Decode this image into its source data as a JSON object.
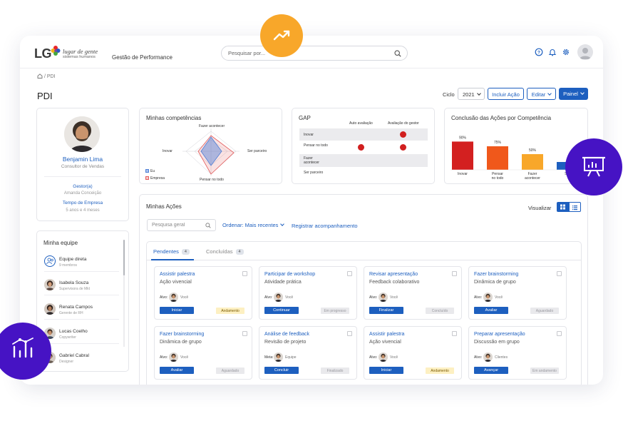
{
  "header": {
    "logo_letters": "LG",
    "logo_tagline": "lugar de gente",
    "logo_subline": "sistemas humanos",
    "app_title": "Gestão de Performance",
    "search_placeholder": "Pesquisar por..."
  },
  "breadcrumb": "/ PDI",
  "page": {
    "title": "PDI",
    "cycle_label": "Ciclo",
    "cycle_value": "2021",
    "btn_incluir": "Incluir Ação",
    "btn_editar": "Editar",
    "btn_painel": "Painel"
  },
  "profile": {
    "name": "Benjamin Lima",
    "role": "Consultor de Vendas",
    "manager_label": "Gestor(a)",
    "manager_value": "Amanda Conceição",
    "tenure_label": "Tempo de Empresa",
    "tenure_value": "5 anos e 4 meses"
  },
  "team": {
    "title": "Minha equipe",
    "members": [
      {
        "name": "Equipe direta",
        "sub": "9 membros"
      },
      {
        "name": "Isabela Souza",
        "sub": "Supervisora de Mkt"
      },
      {
        "name": "Renata Campos",
        "sub": "Gerente de RH"
      },
      {
        "name": "Lucas Coelho",
        "sub": "Copywriter"
      },
      {
        "name": "Gabriel Cabral",
        "sub": "Designer"
      }
    ]
  },
  "competencias": {
    "title": "Minhas competências",
    "axes": [
      "Fazer acontecer",
      "Ser parceiro",
      "Pensar no todo",
      "Inovar"
    ],
    "legend_eu": "Eu",
    "legend_empresa": "Empresa",
    "colors": {
      "eu": "#4f7fd6",
      "empresa": "#e35c5c"
    }
  },
  "gap": {
    "title": "GAP",
    "col_auto": "Auto avaliação",
    "col_gestor": "Avaliação do gestor",
    "rows": [
      "Inovar",
      "Pensar no todo",
      "Fazer acontecer",
      "Ser parceiro"
    ],
    "dot_color": "#d11f1f"
  },
  "chart_data": {
    "type": "bar",
    "title": "Conclusão das Ações por Competência",
    "categories": [
      "Inovar",
      "Pensar no todo",
      "Fazer acontecer",
      "Ser parceiro"
    ],
    "values": [
      90,
      75,
      50,
      25
    ],
    "value_labels": [
      "90%",
      "75%",
      "50%",
      ""
    ],
    "category_labels": [
      "Inovar",
      "Pensar no todo",
      "Fazer acontecer",
      "Ser"
    ],
    "colors": [
      "#d32020",
      "#f0581b",
      "#f8a72a",
      "#1d5fbf"
    ],
    "ylim": [
      0,
      100
    ]
  },
  "acoes": {
    "title": "Minhas Ações",
    "visualizar": "Visualizar",
    "search_placeholder": "Pesquisa geral",
    "ordenar": "Ordenar: Mais recentes",
    "registrar": "Registrar acompanhamento",
    "tabs": [
      {
        "label": "Pendentes",
        "count": "4"
      },
      {
        "label": "Concluídas",
        "count": "4"
      }
    ],
    "cards": [
      {
        "title": "Assistir palestra",
        "sub": "Ação vivencial",
        "meta_lbl": "Alvo:",
        "meta_name": "Você",
        "btn": "Iniciar",
        "status": "Andamento",
        "status_kind": "warn"
      },
      {
        "title": "Participar de workshop",
        "sub": "Atividade prática",
        "meta_lbl": "Alvo:",
        "meta_name": "Você",
        "btn": "Continuar",
        "status": "Em progresso",
        "status_kind": "gray"
      },
      {
        "title": "Revisar apresentação",
        "sub": "Feedback colaborativo",
        "meta_lbl": "Alvo:",
        "meta_name": "Você",
        "btn": "Finalizar",
        "status": "Concluído",
        "status_kind": "gray"
      },
      {
        "title": "Fazer brainstorming",
        "sub": "Dinâmica de grupo",
        "meta_lbl": "Alvo:",
        "meta_name": "Você",
        "btn": "Avaliar",
        "status": "Aguardado",
        "status_kind": "gray"
      },
      {
        "title": "Fazer brainstorming",
        "sub": "Dinâmica de grupo",
        "meta_lbl": "Alvo:",
        "meta_name": "Você",
        "btn": "Avaliar",
        "status": "Aguardado",
        "status_kind": "gray"
      },
      {
        "title": "Análise de feedback",
        "sub": "Revisão de projeto",
        "meta_lbl": "Meta:",
        "meta_name": "Equipe",
        "btn": "Concluir",
        "status": "Finalizado",
        "status_kind": "gray"
      },
      {
        "title": "Assistir palestra",
        "sub": "Ação vivencial",
        "meta_lbl": "Alvo:",
        "meta_name": "Você",
        "btn": "Iniciar",
        "status": "Andamento",
        "status_kind": "warn"
      },
      {
        "title": "Preparar apresentação",
        "sub": "Discussão em grupo",
        "meta_lbl": "Alvo:",
        "meta_name": "Clientes",
        "btn": "Avançar",
        "status": "Em andamento",
        "status_kind": "gray"
      }
    ]
  }
}
